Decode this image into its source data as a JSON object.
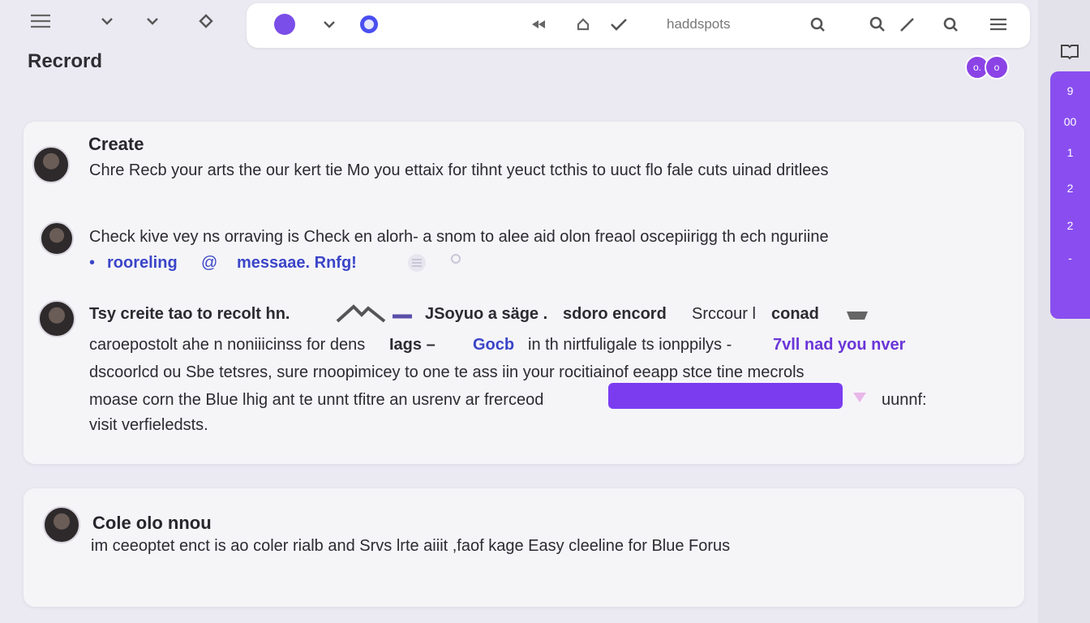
{
  "page": {
    "title": "Recrord"
  },
  "toolbar": {
    "menu_icon": "menu-icon",
    "chevron1": "chevron-down-icon",
    "chevron2": "chevron-down-icon",
    "diamond": "diamond-icon"
  },
  "topbar": {
    "search_text": "haddspots",
    "icons": [
      "purple-dot-icon",
      "chevron-down-icon",
      "blue-dot-icon",
      "back-icon",
      "home-icon",
      "check-icon",
      "search-icon",
      "search-icon",
      "pen-icon",
      "search-icon",
      "menu-icon"
    ]
  },
  "header": {
    "avatar_labels": [
      "o.",
      "o"
    ]
  },
  "side_rail": {
    "items": [
      "9",
      "00",
      "1",
      "2",
      "2",
      "-"
    ]
  },
  "cards": [
    {
      "title": "Create",
      "line1": "Chre Recb your arts the our kert tie Mo you ettaix for tihnt yeuct tcthis to uuct flo fale cuts uinad dritlees"
    },
    {
      "line1": "Check kive vey ns orraving is Check en alorh- a snom to alee aid olon freaol oscepiirigg th ech nguriine",
      "bullet": "•",
      "link": "rooreling",
      "link_icon": "@",
      "message": "messaae. Rnfg!",
      "line3_1": "Tsy creite tao to recolt hn.",
      "line3_2": "JSoyuo a säge .",
      "line3_3": "sdoro encord",
      "line3_4": "Srccour l",
      "line3_5": "conad",
      "line4_1": "caroepostolt ahe n noniiicinss for dens",
      "line4_2": "Iags –",
      "line4_3": "Gocb",
      "line4_4": "in th nirtfuligale ts ionppilys -",
      "line4_5": "7vll nad you nver",
      "line5": "dscoorlcd ou Sbe tetsres, sure rnoopimicey to one te ass iin your rocitiainof eeapp stce tine mecrols",
      "line6": "moase corn the Blue lhig ant te unnt tfitre an usrenv ar frerceod",
      "line6_end": "uunnf:",
      "line7": "visit verfieledsts."
    },
    {
      "title": "Cole olo nnou",
      "line1": "im ceeoptet enct is ao coler rialb and Srvs lrte aiiit ,faof kage Easy cleeline for Blue Forus"
    }
  ]
}
